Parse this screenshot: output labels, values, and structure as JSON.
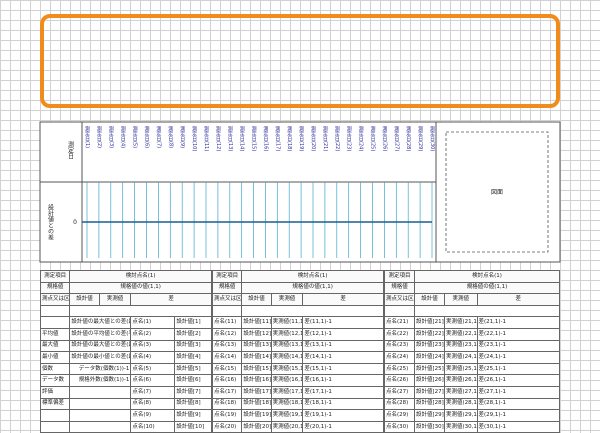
{
  "highlight_box": {
    "color": "#f08c1e"
  },
  "chart": {
    "y_label": "設計値との差",
    "x_header": "測定日",
    "x_dates": [
      "測定日(1)",
      "測定日(2)",
      "測定日(3)",
      "測定日(4)",
      "測定日(5)",
      "測定日(6)",
      "測定日(7)",
      "測定日(8)",
      "測定日(9)",
      "測定日(10)",
      "測定日(11)",
      "測定日(12)",
      "測定日(13)",
      "測定日(14)",
      "測定日(15)",
      "測定日(16)",
      "測定日(17)",
      "測定日(18)",
      "測定日(19)",
      "測定日(20)",
      "測定日(21)",
      "測定日(22)",
      "測定日(23)",
      "測定日(24)",
      "測定日(25)",
      "測定日(26)",
      "測定日(27)",
      "測定日(28)",
      "測定日(29)",
      "測定日(30)"
    ],
    "zero_value": 0,
    "zero_label": "0",
    "series_color": "#1a5e8c",
    "grid_color": "#3fa6c9",
    "figure_label": "図面"
  },
  "table": {
    "blocks": [
      {
        "measure_label": "測定項目",
        "spec_label": "規格値",
        "method_label": "測点又は区別",
        "item_label": "検討点名(1)",
        "item_sub": "規格値の値(1,1)",
        "design_label": "設計値",
        "actual_label": "実測値",
        "diff_label": "差",
        "rows": [
          {
            "pt": "点名(1)",
            "d": "設計値[1]",
            "a": "実測値(1,1)",
            "df": "差(1,1)-1"
          },
          {
            "pt": "点名(2)",
            "d": "設計値[2]",
            "a": "実測値(2,1)",
            "df": "差(2,1)-1"
          },
          {
            "pt": "点名(3)",
            "d": "設計値[3]",
            "a": "実測値(3,1)",
            "df": "差(3,1)-1"
          },
          {
            "pt": "点名(4)",
            "d": "設計値[4]",
            "a": "実測値(4,1)",
            "df": "差(4,1)-1"
          },
          {
            "pt": "点名(5)",
            "d": "設計値[5]",
            "a": "実測値(5,1)",
            "df": "差(5,1)-1"
          },
          {
            "pt": "点名(6)",
            "d": "設計値[6]",
            "a": "実測値(6,1)",
            "df": "差(6,1)-1"
          },
          {
            "pt": "点名(7)",
            "d": "設計値[7]",
            "a": "実測値(7,1)",
            "df": "差(7,1)-1"
          },
          {
            "pt": "点名(8)",
            "d": "設計値[8]",
            "a": "実測値(8,1)",
            "df": "差(8,1)-1"
          },
          {
            "pt": "点名(9)",
            "d": "設計値[9]",
            "a": "実測値(9,1)",
            "df": "差(9,1)-1"
          },
          {
            "pt": "点名(10)",
            "d": "設計値[10]",
            "a": "実測値(10,1)",
            "df": "差(10,1)-1"
          }
        ]
      },
      {
        "measure_label": "測定項目",
        "spec_label": "規格値",
        "method_label": "測点又は区別",
        "item_label": "検討点名(1)",
        "item_sub": "規格値の値(1,1)",
        "design_label": "設計値",
        "actual_label": "実測値",
        "diff_label": "差",
        "rows": [
          {
            "pt": "点名(11)",
            "d": "設計値[11]",
            "a": "実測値(11,1)",
            "df": "差(11,1)-1"
          },
          {
            "pt": "点名(12)",
            "d": "設計値[12]",
            "a": "実測値(12,1)",
            "df": "差(12,1)-1"
          },
          {
            "pt": "点名(13)",
            "d": "設計値[13]",
            "a": "実測値(13,1)",
            "df": "差(13,1)-1"
          },
          {
            "pt": "点名(14)",
            "d": "設計値[14]",
            "a": "実測値(14,1)",
            "df": "差(14,1)-1"
          },
          {
            "pt": "点名(15)",
            "d": "設計値[15]",
            "a": "実測値(15,1)",
            "df": "差(15,1)-1"
          },
          {
            "pt": "点名(16)",
            "d": "設計値[16]",
            "a": "実測値(16,1)",
            "df": "差(16,1)-1"
          },
          {
            "pt": "点名(17)",
            "d": "設計値[17]",
            "a": "実測値(17,1)",
            "df": "差(17,1)-1"
          },
          {
            "pt": "点名(18)",
            "d": "設計値[18]",
            "a": "実測値(18,1)",
            "df": "差(18,1)-1"
          },
          {
            "pt": "点名(19)",
            "d": "設計値[19]",
            "a": "実測値(19,1)",
            "df": "差(19,1)-1"
          },
          {
            "pt": "点名(20)",
            "d": "設計値[20]",
            "a": "実測値(20,1)",
            "df": "差(20,1)-1"
          }
        ]
      },
      {
        "measure_label": "測定項目",
        "spec_label": "規格値",
        "method_label": "測点又は区別",
        "item_label": "検討点名(1)",
        "item_sub": "規格値の値(1,1)",
        "design_label": "設計値",
        "actual_label": "実測値",
        "diff_label": "差",
        "rows": [
          {
            "pt": "点名(21)",
            "d": "設計値[21]",
            "a": "実測値(21,1)",
            "df": "差(21,1)-1"
          },
          {
            "pt": "点名(22)",
            "d": "設計値[22]",
            "a": "実測値(22,1)",
            "df": "差(22,1)-1"
          },
          {
            "pt": "点名(23)",
            "d": "設計値[23]",
            "a": "実測値(23,1)",
            "df": "差(23,1)-1"
          },
          {
            "pt": "点名(24)",
            "d": "設計値[24]",
            "a": "実測値(24,1)",
            "df": "差(24,1)-1"
          },
          {
            "pt": "点名(25)",
            "d": "設計値[25]",
            "a": "実測値(25,1)",
            "df": "差(25,1)-1"
          },
          {
            "pt": "点名(26)",
            "d": "設計値[26]",
            "a": "実測値(26,1)",
            "df": "差(26,1)-1"
          },
          {
            "pt": "点名(27)",
            "d": "設計値[27]",
            "a": "実測値(27,1)",
            "df": "差(27,1)-1"
          },
          {
            "pt": "点名(28)",
            "d": "設計値[28]",
            "a": "実測値(28,1)",
            "df": "差(28,1)-1"
          },
          {
            "pt": "点名(29)",
            "d": "設計値[29]",
            "a": "実測値(29,1)",
            "df": "差(29,1)-1"
          },
          {
            "pt": "点名(30)",
            "d": "設計値[30]",
            "a": "実測値(30,1)",
            "df": "差(30,1)-1"
          }
        ]
      }
    ],
    "stats": [
      {
        "label": "",
        "text": "設計値の最大値との差(最大値(1))-1"
      },
      {
        "label": "平均値",
        "text": "設計値の平均値との差(平均値(1))-1"
      },
      {
        "label": "最大値",
        "text": "設計値の最大値との差(最大値(1))-1"
      },
      {
        "label": "最小値",
        "text": "設計値の最小値との差(最小値(1))-1"
      },
      {
        "label": "個数",
        "text": "データ数(個数(1))-1"
      },
      {
        "label": "データ数",
        "text": "規格外数(個数(1))-1"
      },
      {
        "label": "評価",
        "text": ""
      },
      {
        "label": "標準偏差",
        "text": ""
      }
    ]
  }
}
